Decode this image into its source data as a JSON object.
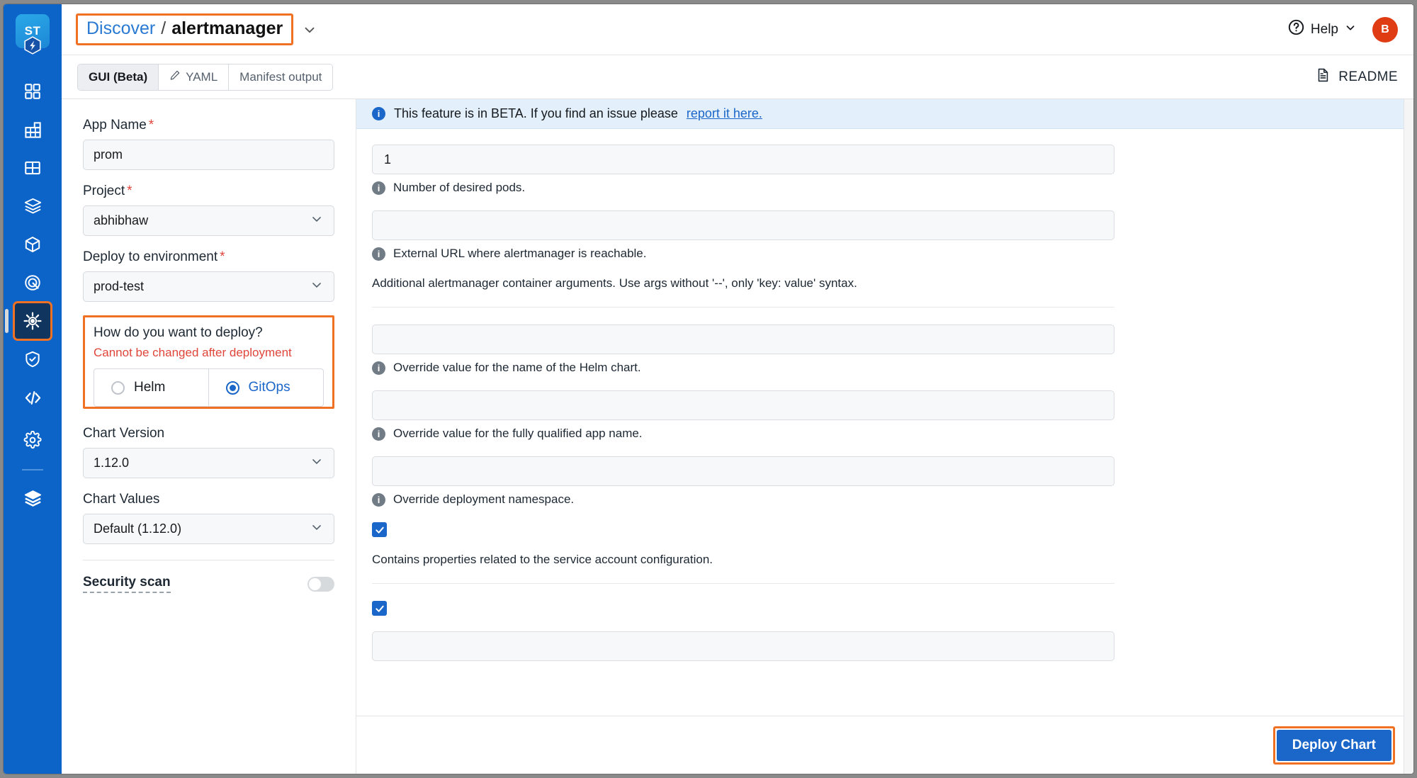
{
  "rail": {
    "logo_text": "ST",
    "items": [
      {
        "name": "dashboard",
        "icon": "grid-squares-icon"
      },
      {
        "name": "applications",
        "icon": "chart-blocks-icon"
      },
      {
        "name": "clusters",
        "icon": "grid-table-icon"
      },
      {
        "name": "stacks",
        "icon": "layers-box-icon"
      },
      {
        "name": "packages",
        "icon": "cube-icon"
      },
      {
        "name": "targets",
        "icon": "target-icon"
      },
      {
        "name": "deploy",
        "icon": "helm-wheel-icon"
      },
      {
        "name": "security",
        "icon": "shield-check-icon"
      },
      {
        "name": "code",
        "icon": "code-brackets-icon"
      },
      {
        "name": "settings",
        "icon": "gear-icon"
      },
      {
        "name": "environments",
        "icon": "stack-layers-icon"
      }
    ]
  },
  "header": {
    "breadcrumb_root": "Discover",
    "breadcrumb_sep": "/",
    "breadcrumb_current": "alertmanager",
    "help_label": "Help",
    "avatar_initial": "B"
  },
  "tabs": {
    "items": [
      {
        "label": "GUI (Beta)",
        "active": true,
        "icon": ""
      },
      {
        "label": "YAML",
        "active": false,
        "icon": "pencil-icon"
      },
      {
        "label": "Manifest output",
        "active": false,
        "icon": ""
      }
    ],
    "readme_label": "README"
  },
  "form": {
    "app_name": {
      "label": "App Name",
      "required": true,
      "value": "prom",
      "placeholder": ""
    },
    "project": {
      "label": "Project",
      "required": true,
      "value": "abhibhaw"
    },
    "environment": {
      "label": "Deploy to environment",
      "required": true,
      "value": "prod-test"
    },
    "deploy_mode": {
      "question": "How do you want to deploy?",
      "warning": "Cannot be changed after deployment",
      "options": [
        {
          "label": "Helm",
          "selected": false
        },
        {
          "label": "GitOps",
          "selected": true
        }
      ]
    },
    "chart_version": {
      "label": "Chart Version",
      "value": "1.12.0"
    },
    "chart_values": {
      "label": "Chart Values",
      "value": "Default (1.12.0)"
    },
    "security_scan": {
      "label": "Security scan",
      "enabled": false
    }
  },
  "content": {
    "banner": {
      "text": "This feature is in BETA. If you find an issue please ",
      "link_text": "report it here."
    },
    "fields": [
      {
        "kind": "input",
        "value": "1",
        "help": "Number of desired pods."
      },
      {
        "kind": "input",
        "value": "",
        "help": "External URL where alertmanager is reachable."
      },
      {
        "kind": "text",
        "text": "Additional alertmanager container arguments. Use args without '--', only 'key: value' syntax."
      },
      {
        "kind": "divider"
      },
      {
        "kind": "input",
        "value": "",
        "help": "Override value for the name of the Helm chart."
      },
      {
        "kind": "input",
        "value": "",
        "help": "Override value for the fully qualified app name."
      },
      {
        "kind": "input",
        "value": "",
        "help": "Override deployment namespace."
      },
      {
        "kind": "checkbox",
        "checked": true
      },
      {
        "kind": "text",
        "text": "Contains properties related to the service account configuration."
      },
      {
        "kind": "divider"
      },
      {
        "kind": "checkbox",
        "checked": true
      },
      {
        "kind": "input",
        "value": "",
        "help": ""
      }
    ]
  },
  "footer": {
    "deploy_label": "Deploy Chart"
  },
  "colors": {
    "rail_blue": "#0c64c8",
    "accent_orange": "#f07123",
    "primary_blue": "#1b66c9",
    "error_red": "#e0453a",
    "avatar_red": "#e03c14"
  }
}
